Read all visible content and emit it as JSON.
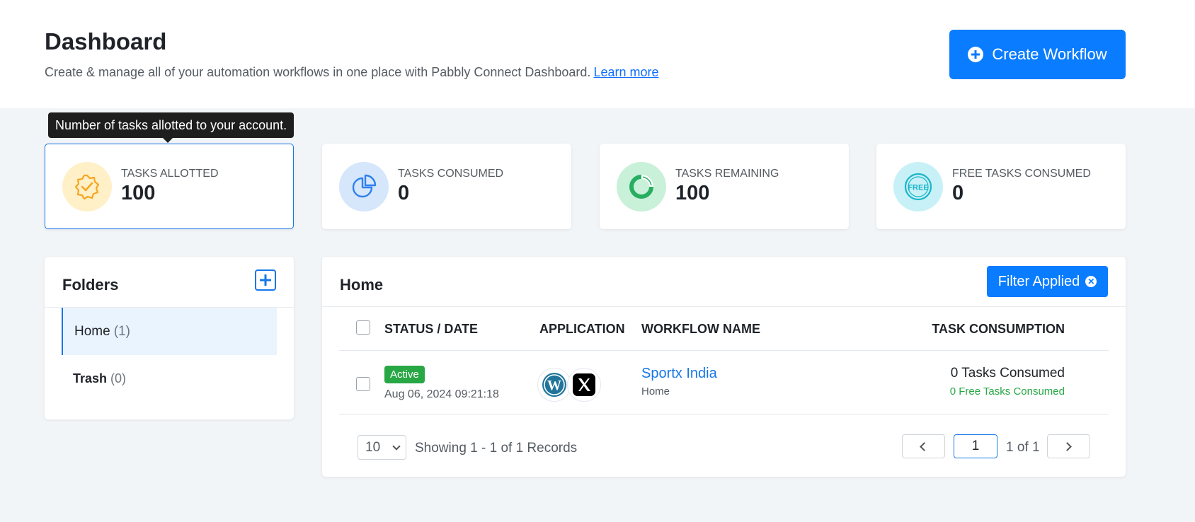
{
  "header": {
    "title": "Dashboard",
    "subtitle": "Create & manage all of your automation workflows in one place with Pabbly Connect Dashboard.",
    "learn_more": "Learn more",
    "create_button": "Create Workflow"
  },
  "tooltip": "Number of tasks allotted to your account.",
  "stats": [
    {
      "label": "TASKS ALLOTTED",
      "value": "100",
      "icon": "badge-check-icon",
      "color": "#f5a623"
    },
    {
      "label": "TASKS CONSUMED",
      "value": "0",
      "icon": "pie-chart-icon",
      "color": "#2f80ed"
    },
    {
      "label": "TASKS REMAINING",
      "value": "100",
      "icon": "donut-chart-icon",
      "color": "#27ae60"
    },
    {
      "label": "FREE TASKS CONSUMED",
      "value": "0",
      "icon": "free-icon",
      "color": "#1ab5c9"
    }
  ],
  "folders": {
    "title": "Folders",
    "items": [
      {
        "name": "Home",
        "count": "(1)"
      },
      {
        "name": "Trash",
        "count": "(0)"
      }
    ]
  },
  "workflows": {
    "title": "Home",
    "filter_button": "Filter Applied",
    "columns": {
      "status": "STATUS / DATE",
      "application": "APPLICATION",
      "name": "WORKFLOW NAME",
      "consumption": "TASK CONSUMPTION"
    },
    "rows": [
      {
        "status": "Active",
        "date": "Aug 06, 2024 09:21:18",
        "apps": [
          "wordpress-icon",
          "x-twitter-icon"
        ],
        "name": "Sportx India",
        "folder": "Home",
        "tasks": "0 Tasks Consumed",
        "free_tasks": "0 Free Tasks Consumed"
      }
    ],
    "pagination": {
      "per_page": "10",
      "showing": "Showing 1 - 1 of 1 Records",
      "current_page": "1",
      "of_pages": "1 of 1"
    }
  },
  "colors": {
    "primary": "#0a7cff",
    "active_badge": "#28a745"
  }
}
